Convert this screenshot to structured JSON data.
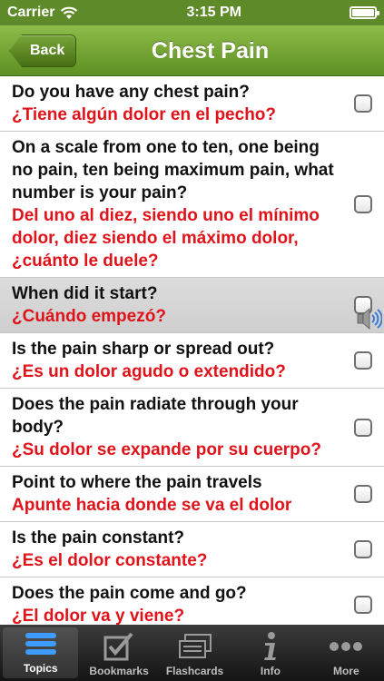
{
  "status": {
    "carrier": "Carrier",
    "time": "3:15 PM"
  },
  "nav": {
    "back_label": "Back",
    "title": "Chest Pain"
  },
  "questions": [
    {
      "en": "Do you have any chest pain?",
      "es": "¿Tiene algún dolor en el pecho?"
    },
    {
      "en": "On a scale from one to ten, one being no pain, ten being maximum pain, what number is your pain?",
      "es": "Del uno al diez, siendo uno el mínimo dolor, diez siendo el máximo dolor, ¿cuánto le duele?"
    },
    {
      "en": "When did it start?",
      "es": "¿Cuándo empezó?"
    },
    {
      "en": "Is the pain sharp or spread out?",
      "es": "¿Es un dolor agudo o extendido?"
    },
    {
      "en": "Does the pain radiate through your body?",
      "es": "¿Su dolor se expande por su cuerpo?"
    },
    {
      "en": "Point to where the pain travels",
      "es": "Apunte hacia donde se va el dolor"
    },
    {
      "en": "Is the pain constant?",
      "es": "¿Es el dolor constante?"
    },
    {
      "en": "Does the pain come and go?",
      "es": "¿El dolor va y viene?"
    }
  ],
  "tabs": [
    {
      "label": "Topics",
      "icon": "list-icon"
    },
    {
      "label": "Bookmarks",
      "icon": "checkbox-icon"
    },
    {
      "label": "Flashcards",
      "icon": "cards-icon"
    },
    {
      "label": "Info",
      "icon": "info-icon"
    },
    {
      "label": "More",
      "icon": "more-icon"
    }
  ],
  "colors": {
    "nav_green": "#5d8f22",
    "spanish_red": "#e0131b"
  }
}
